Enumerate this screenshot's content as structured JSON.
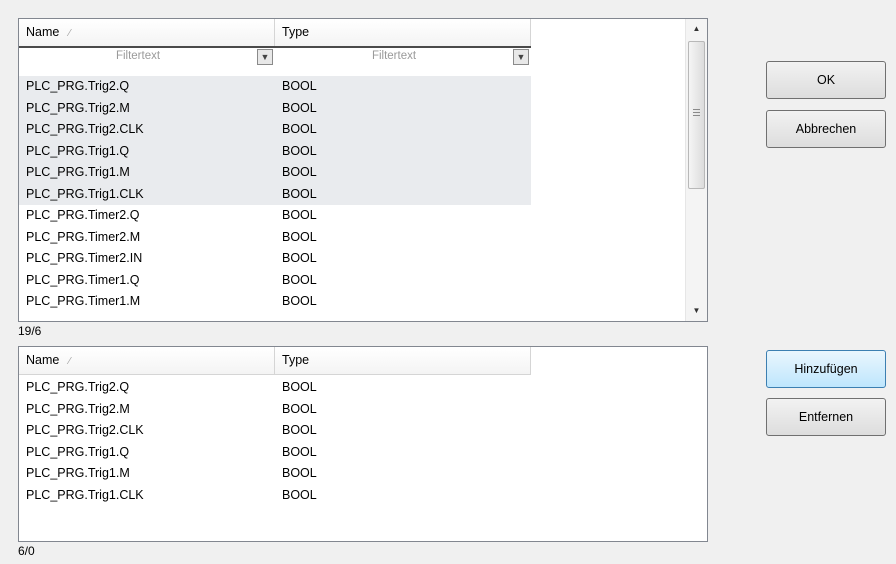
{
  "available": {
    "columns": {
      "name": "Name",
      "type": "Type"
    },
    "filter_placeholder": "Filtertext",
    "rows": [
      {
        "name": "PLC_PRG.Trig2.Q",
        "type": "BOOL",
        "selected": true
      },
      {
        "name": "PLC_PRG.Trig2.M",
        "type": "BOOL",
        "selected": true
      },
      {
        "name": "PLC_PRG.Trig2.CLK",
        "type": "BOOL",
        "selected": true
      },
      {
        "name": "PLC_PRG.Trig1.Q",
        "type": "BOOL",
        "selected": true
      },
      {
        "name": "PLC_PRG.Trig1.M",
        "type": "BOOL",
        "selected": true
      },
      {
        "name": "PLC_PRG.Trig1.CLK",
        "type": "BOOL",
        "selected": true
      },
      {
        "name": "PLC_PRG.Timer2.Q",
        "type": "BOOL",
        "selected": false
      },
      {
        "name": "PLC_PRG.Timer2.M",
        "type": "BOOL",
        "selected": false
      },
      {
        "name": "PLC_PRG.Timer2.IN",
        "type": "BOOL",
        "selected": false
      },
      {
        "name": "PLC_PRG.Timer1.Q",
        "type": "BOOL",
        "selected": false
      },
      {
        "name": "PLC_PRG.Timer1.M",
        "type": "BOOL",
        "selected": false
      }
    ],
    "status": "19/6"
  },
  "chosen": {
    "columns": {
      "name": "Name",
      "type": "Type"
    },
    "rows": [
      {
        "name": "PLC_PRG.Trig2.Q",
        "type": "BOOL"
      },
      {
        "name": "PLC_PRG.Trig2.M",
        "type": "BOOL"
      },
      {
        "name": "PLC_PRG.Trig2.CLK",
        "type": "BOOL"
      },
      {
        "name": "PLC_PRG.Trig1.Q",
        "type": "BOOL"
      },
      {
        "name": "PLC_PRG.Trig1.M",
        "type": "BOOL"
      },
      {
        "name": "PLC_PRG.Trig1.CLK",
        "type": "BOOL"
      }
    ],
    "status": "6/0"
  },
  "buttons": {
    "ok": "OK",
    "cancel": "Abbrechen",
    "add": "Hinzufügen",
    "remove": "Entfernen"
  },
  "icons": {
    "sort": "sort-indicator-icon",
    "filter": "filter-funnel-icon",
    "scroll_up": "scroll-up-arrow-icon",
    "scroll_down": "scroll-down-arrow-icon"
  },
  "colors": {
    "selected_row": "#e9ebee",
    "focus_button": "#bee6fd"
  }
}
